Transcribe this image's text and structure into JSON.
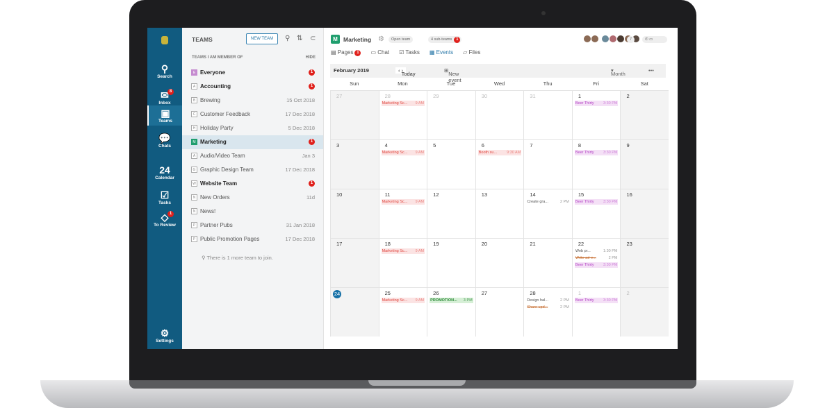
{
  "rail": {
    "items": [
      {
        "label": "Search",
        "icon": "search-icon"
      },
      {
        "label": "Inbox",
        "icon": "inbox-icon",
        "badge": "8"
      },
      {
        "label": "Teams",
        "icon": "teams-icon"
      },
      {
        "label": "Chats",
        "icon": "chat-icon"
      },
      {
        "label": "Calendar",
        "icon": "calendar-icon",
        "day": "24"
      },
      {
        "label": "Tasks",
        "icon": "tasks-icon"
      },
      {
        "label": "To Review",
        "icon": "review-icon",
        "badge": "1"
      }
    ],
    "settings": "Settings"
  },
  "teams": {
    "title": "TEAMS",
    "new_team": "NEW TEAM",
    "section": "TEAMS I AM MEMBER OF",
    "hide": "HIDE",
    "rows": [
      {
        "letter": "E",
        "name": "Everyone",
        "badge": "1",
        "bold": true
      },
      {
        "letter": "A",
        "name": "Accounting",
        "badge": "1",
        "bold": true
      },
      {
        "letter": "B",
        "name": "Brewing",
        "date": "15 Oct 2018"
      },
      {
        "letter": "C",
        "name": "Customer Feedback",
        "date": "17 Dec 2018"
      },
      {
        "letter": "H",
        "name": "Holiday Party",
        "date": "5 Dec 2018"
      },
      {
        "letter": "M",
        "name": "Marketing",
        "badge": "1",
        "bold": true,
        "selected": true
      },
      {
        "letter": "A",
        "name": "Audio/Video Team",
        "date": "Jan 3"
      },
      {
        "letter": "G",
        "name": "Graphic Design Team",
        "date": "17 Dec 2018"
      },
      {
        "letter": "W",
        "name": "Website Team",
        "badge": "1",
        "bold": true
      },
      {
        "letter": "N",
        "name": "New Orders",
        "date": "11d"
      },
      {
        "letter": "N",
        "name": "News!"
      },
      {
        "letter": "P",
        "name": "Partner Pubs",
        "date": "31 Jan 2018"
      },
      {
        "letter": "P",
        "name": "Public Promotion Pages",
        "date": "17 Dec 2018"
      }
    ],
    "join": "There is 1 more team to join."
  },
  "main": {
    "logo": "M",
    "title": "Marketing",
    "open_team": "Open team",
    "subteams": "4 sub-teams",
    "subteams_badge": "1",
    "members_count": "7",
    "tabs": [
      {
        "label": "Pages",
        "badge": "1"
      },
      {
        "label": "Chat"
      },
      {
        "label": "Tasks"
      },
      {
        "label": "Events",
        "active": true
      },
      {
        "label": "Files"
      }
    ],
    "month": "February 2019",
    "today": "Today",
    "new_event": "New event",
    "view": "Month",
    "more": "•••",
    "days": [
      "Sun",
      "Mon",
      "Tue",
      "Wed",
      "Thu",
      "Fri",
      "Sat"
    ],
    "weeks": [
      [
        {
          "d": "27",
          "out": true
        },
        {
          "d": "28",
          "out": true,
          "ev": [
            {
              "l": "Marketing Sc...",
              "t": "9 AM",
              "c": "red"
            }
          ]
        },
        {
          "d": "29",
          "out": true
        },
        {
          "d": "30",
          "out": true
        },
        {
          "d": "31",
          "out": true
        },
        {
          "d": "1",
          "ev": [
            {
              "l": "Beer Thirty",
              "t": "3:30 PM",
              "c": "purple"
            }
          ]
        },
        {
          "d": "2"
        }
      ],
      [
        {
          "d": "3"
        },
        {
          "d": "4",
          "ev": [
            {
              "l": "Marketing Sc...",
              "t": "9 AM",
              "c": "red"
            }
          ]
        },
        {
          "d": "5"
        },
        {
          "d": "6",
          "ev": [
            {
              "l": "Booth su...",
              "t": "9:30 AM",
              "c": "red"
            }
          ]
        },
        {
          "d": "7"
        },
        {
          "d": "8",
          "ev": [
            {
              "l": "Beer Thirty",
              "t": "3:30 PM",
              "c": "purple"
            }
          ]
        },
        {
          "d": "9"
        }
      ],
      [
        {
          "d": "10"
        },
        {
          "d": "11",
          "ev": [
            {
              "l": "Marketing Sc...",
              "t": "9 AM",
              "c": "red"
            }
          ]
        },
        {
          "d": "12"
        },
        {
          "d": "13"
        },
        {
          "d": "14",
          "ev": [
            {
              "l": "Create gra...",
              "t": "2 PM",
              "c": "task"
            }
          ]
        },
        {
          "d": "15",
          "ev": [
            {
              "l": "Beer Thirty",
              "t": "3:30 PM",
              "c": "purple"
            }
          ]
        },
        {
          "d": "16"
        }
      ],
      [
        {
          "d": "17"
        },
        {
          "d": "18",
          "ev": [
            {
              "l": "Marketing Sc...",
              "t": "9 AM",
              "c": "red"
            }
          ]
        },
        {
          "d": "19"
        },
        {
          "d": "20"
        },
        {
          "d": "21"
        },
        {
          "d": "22",
          "ev": [
            {
              "l": "Web pr...",
              "t": "1:30 PM",
              "c": "task"
            },
            {
              "l": "Write ad-e...",
              "t": "2 PM",
              "c": "task strike"
            },
            {
              "l": "Beer Thirty",
              "t": "3:30 PM",
              "c": "purple"
            }
          ]
        },
        {
          "d": "23"
        }
      ],
      [
        {
          "d": "24",
          "today": true
        },
        {
          "d": "25",
          "ev": [
            {
              "l": "Marketing Sc...",
              "t": "9 AM",
              "c": "red"
            }
          ]
        },
        {
          "d": "26",
          "ev": [
            {
              "l": "PROMOTION...",
              "t": "3 PM",
              "c": "green"
            }
          ]
        },
        {
          "d": "27"
        },
        {
          "d": "28",
          "ev": [
            {
              "l": "Design hal...",
              "t": "2 PM",
              "c": "task"
            },
            {
              "l": "Share upd...",
              "t": "2 PM",
              "c": "task strike"
            }
          ]
        },
        {
          "d": "1",
          "out": true,
          "ev": [
            {
              "l": "Beer Thirty",
              "t": "3:30 PM",
              "c": "purple"
            }
          ]
        },
        {
          "d": "2",
          "out": true
        }
      ]
    ]
  }
}
